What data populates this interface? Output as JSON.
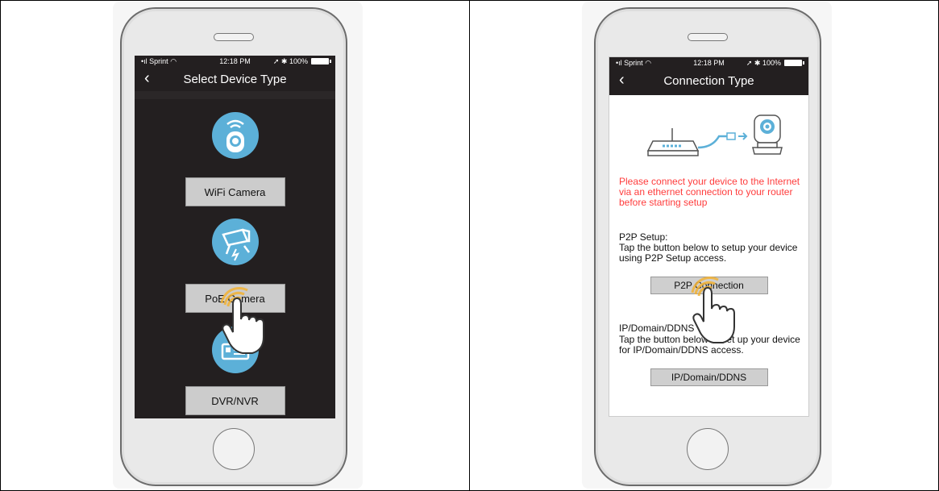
{
  "left_phone": {
    "status": {
      "carrier": "Sprint",
      "time": "12:18 PM",
      "battery": "100%"
    },
    "title": "Select Device Type",
    "back_glyph": "‹",
    "devices": [
      {
        "label": "WiFi Camera",
        "icon": "wifi-camera-icon"
      },
      {
        "label": "PoE Camera",
        "icon": "poe-camera-icon"
      },
      {
        "label": "DVR/NVR",
        "icon": "dvr-nvr-icon"
      }
    ]
  },
  "right_phone": {
    "status": {
      "carrier": "Sprint",
      "time": "12:18 PM",
      "battery": "100%"
    },
    "title": "Connection Type",
    "back_glyph": "‹",
    "warning": "Please connect your device to the Internet via an ethernet connection to your router before starting setup",
    "p2p": {
      "heading": "P2P Setup:",
      "description": "Tap the button below to setup your device using P2P Setup access.",
      "button": "P2P Connection"
    },
    "ip": {
      "heading": "IP/Domain/DDNS",
      "description": "Tap the button below to set up your device for IP/Domain/DDNS access.",
      "button": "IP/Domain/DDNS"
    }
  },
  "colors": {
    "dark_screen": "#231f20",
    "accent_blue": "#5cb0d8",
    "warning_red": "#ff3c3c"
  }
}
